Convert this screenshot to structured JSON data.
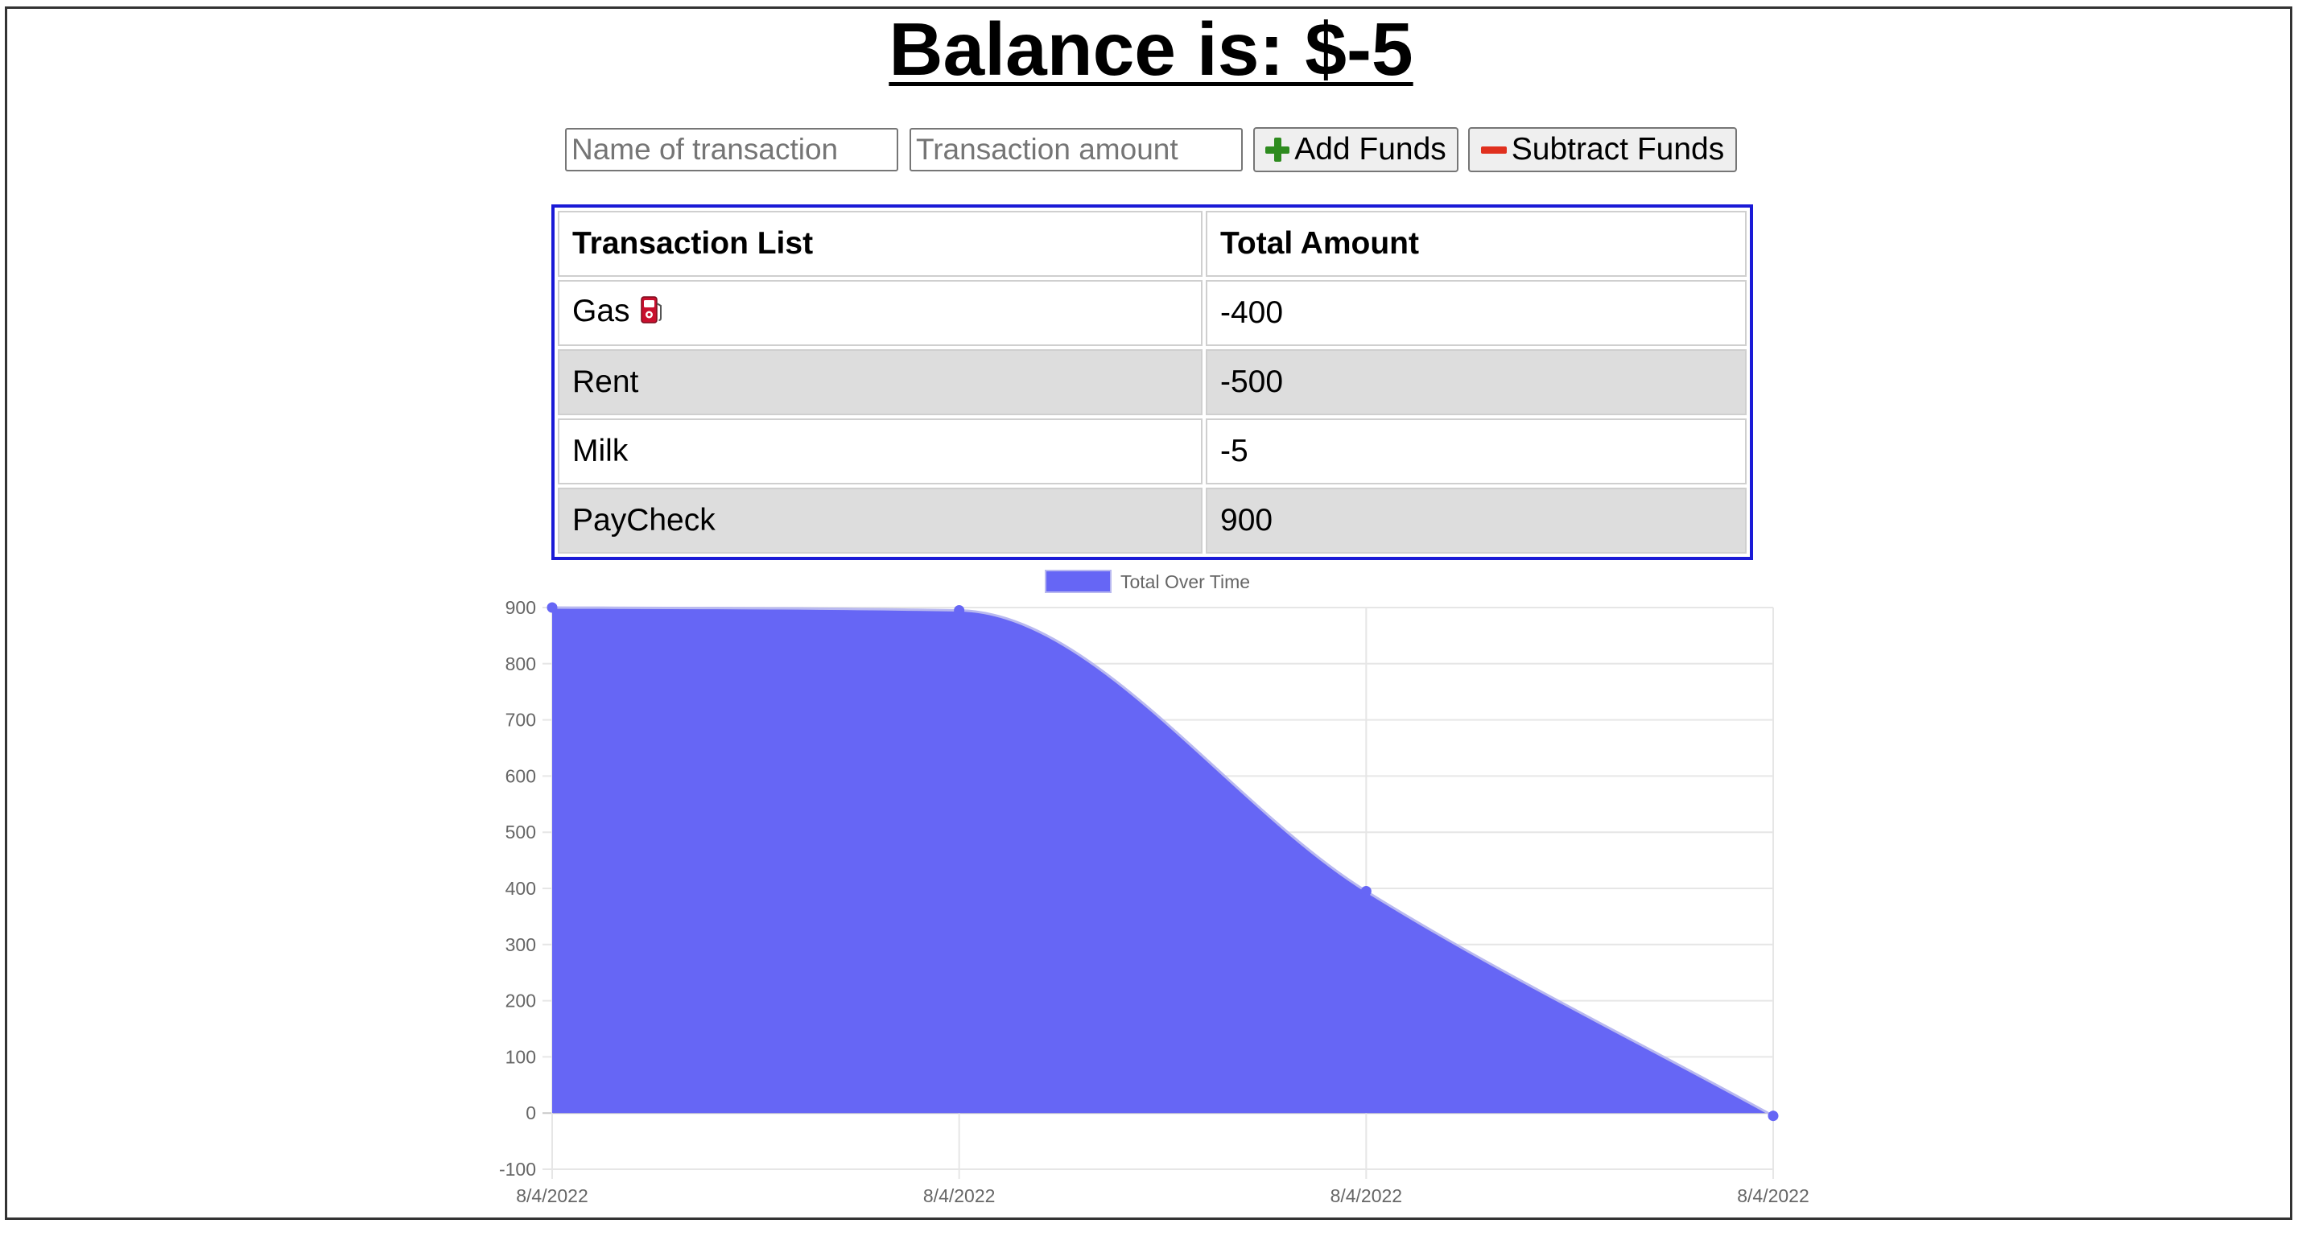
{
  "page": {
    "title": "Balance is: $-5"
  },
  "form": {
    "name_placeholder": "Name of transaction",
    "amount_placeholder": "Transaction amount",
    "add_label": "Add Funds",
    "subtract_label": "Subtract Funds",
    "add_icon": "plus-icon",
    "subtract_icon": "minus-icon"
  },
  "table": {
    "headers": [
      "Transaction List",
      "Total Amount"
    ],
    "rows": [
      {
        "name": "Gas",
        "amount": "-400",
        "icon": "fuel-pump-icon"
      },
      {
        "name": "Rent",
        "amount": "-500"
      },
      {
        "name": "Milk",
        "amount": "-5"
      },
      {
        "name": "PayCheck",
        "amount": "900"
      }
    ]
  },
  "colors": {
    "table_border": "#1a1ad6",
    "area_fill": "#6666f5",
    "area_line": "#b8b8f0",
    "add_icon": "#2e8b1f",
    "subtract_icon": "#e0301e"
  },
  "chart_data": {
    "type": "area",
    "legend": "Total Over Time",
    "legend_position": "top-center",
    "x": [
      "8/4/2022",
      "8/4/2022",
      "8/4/2022",
      "8/4/2022"
    ],
    "series": [
      {
        "name": "Total Over Time",
        "values": [
          900,
          895,
          395,
          -5
        ]
      }
    ],
    "ylim": [
      -100,
      900
    ],
    "yticks": [
      -100,
      0,
      100,
      200,
      300,
      400,
      500,
      600,
      700,
      800,
      900
    ],
    "grid": true,
    "smooth": true
  }
}
